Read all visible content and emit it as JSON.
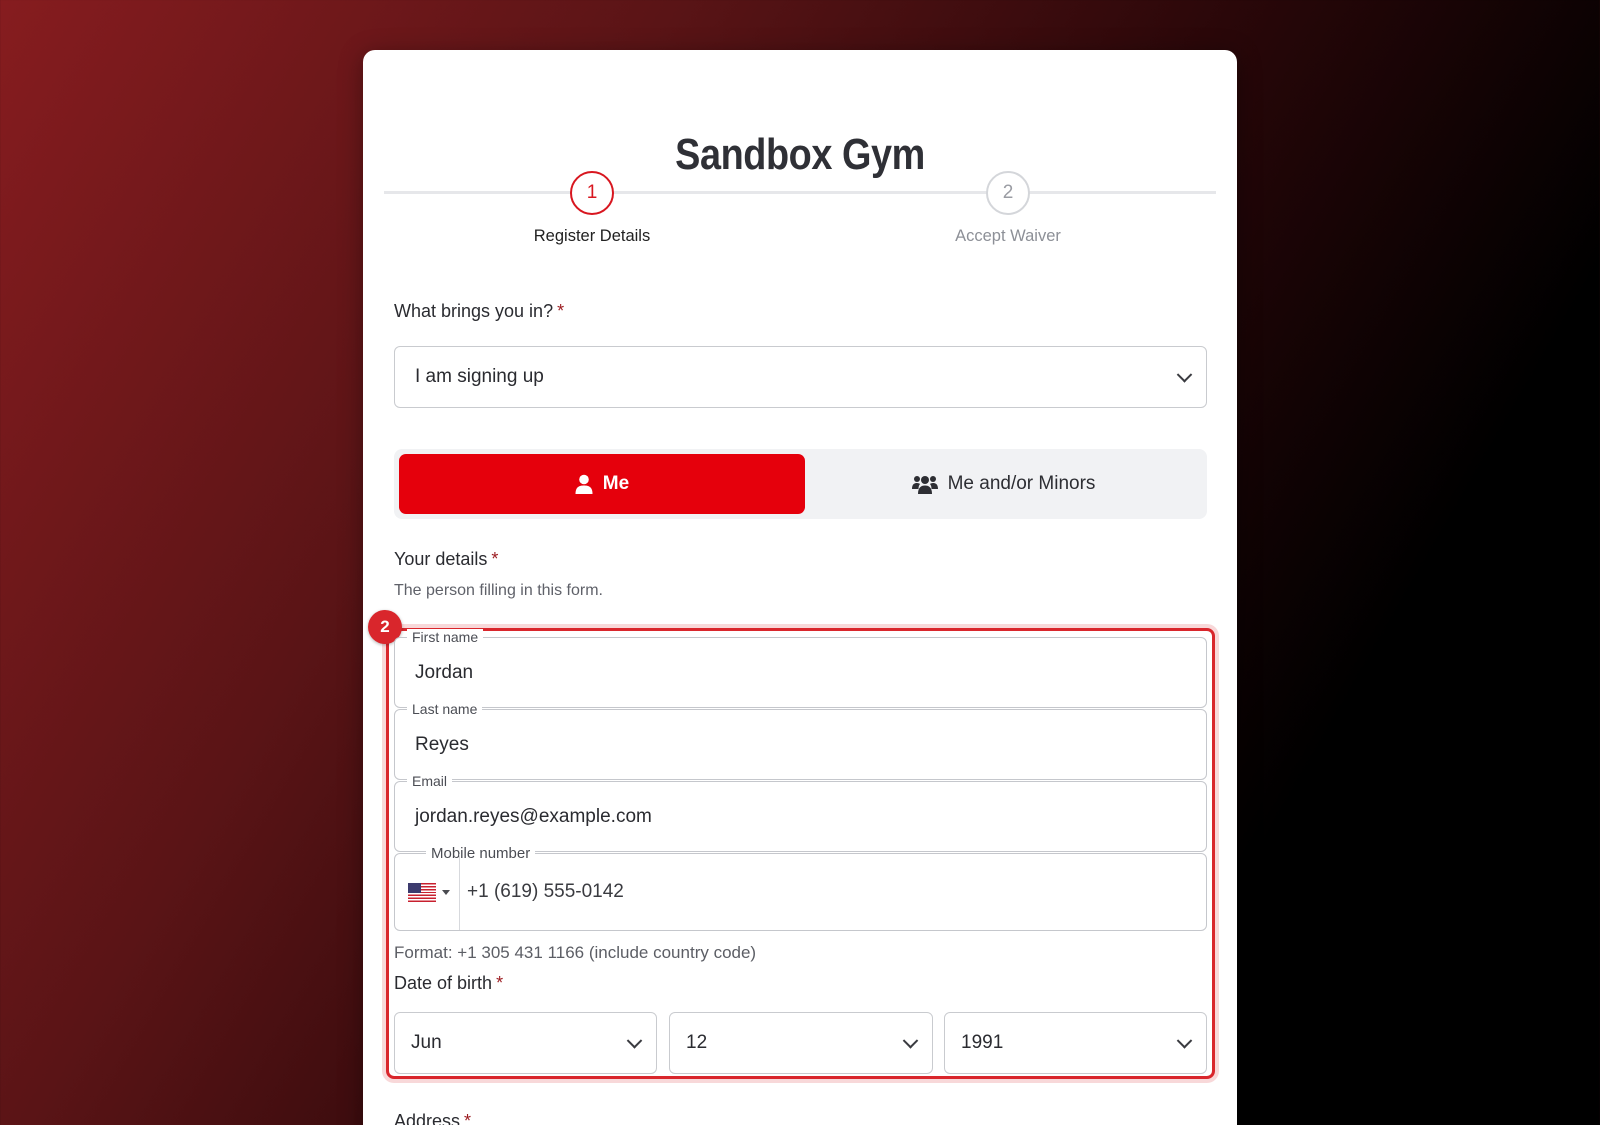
{
  "brand": {
    "title": "Sandbox Gym",
    "accent": "#e5000c"
  },
  "stepper": [
    {
      "number": "1",
      "label": "Register Details",
      "state": "active"
    },
    {
      "number": "2",
      "label": "Accept Waiver",
      "state": "inactive"
    }
  ],
  "purpose": {
    "label": "What brings you in?",
    "required_mark": "*",
    "value": "I am signing up"
  },
  "registrant_toggle": {
    "me_label": "Me",
    "me_icon": "user-icon",
    "minors_label": "Me and/or Minors",
    "minors_icon": "users-icon",
    "selected": "Me"
  },
  "details": {
    "label": "Your details",
    "required_mark": "*",
    "sublabel": "The person filling in this form.",
    "highlight_badge": "2",
    "first_name": {
      "label": "First name",
      "value": "Jordan"
    },
    "last_name": {
      "label": "Last name",
      "value": "Reyes"
    },
    "email": {
      "label": "Email",
      "value": "jordan.reyes@example.com"
    },
    "mobile": {
      "label": "Mobile number",
      "value": "+1 (619) 555-0142",
      "country_icon": "us-flag-icon",
      "hint": "Format: +1 305 431 1166 (include country code)"
    }
  },
  "dob": {
    "label": "Date of birth",
    "required_mark": "*",
    "month": "Jun",
    "day": "12",
    "year": "1991"
  },
  "address": {
    "label": "Address",
    "required_mark": "*"
  }
}
